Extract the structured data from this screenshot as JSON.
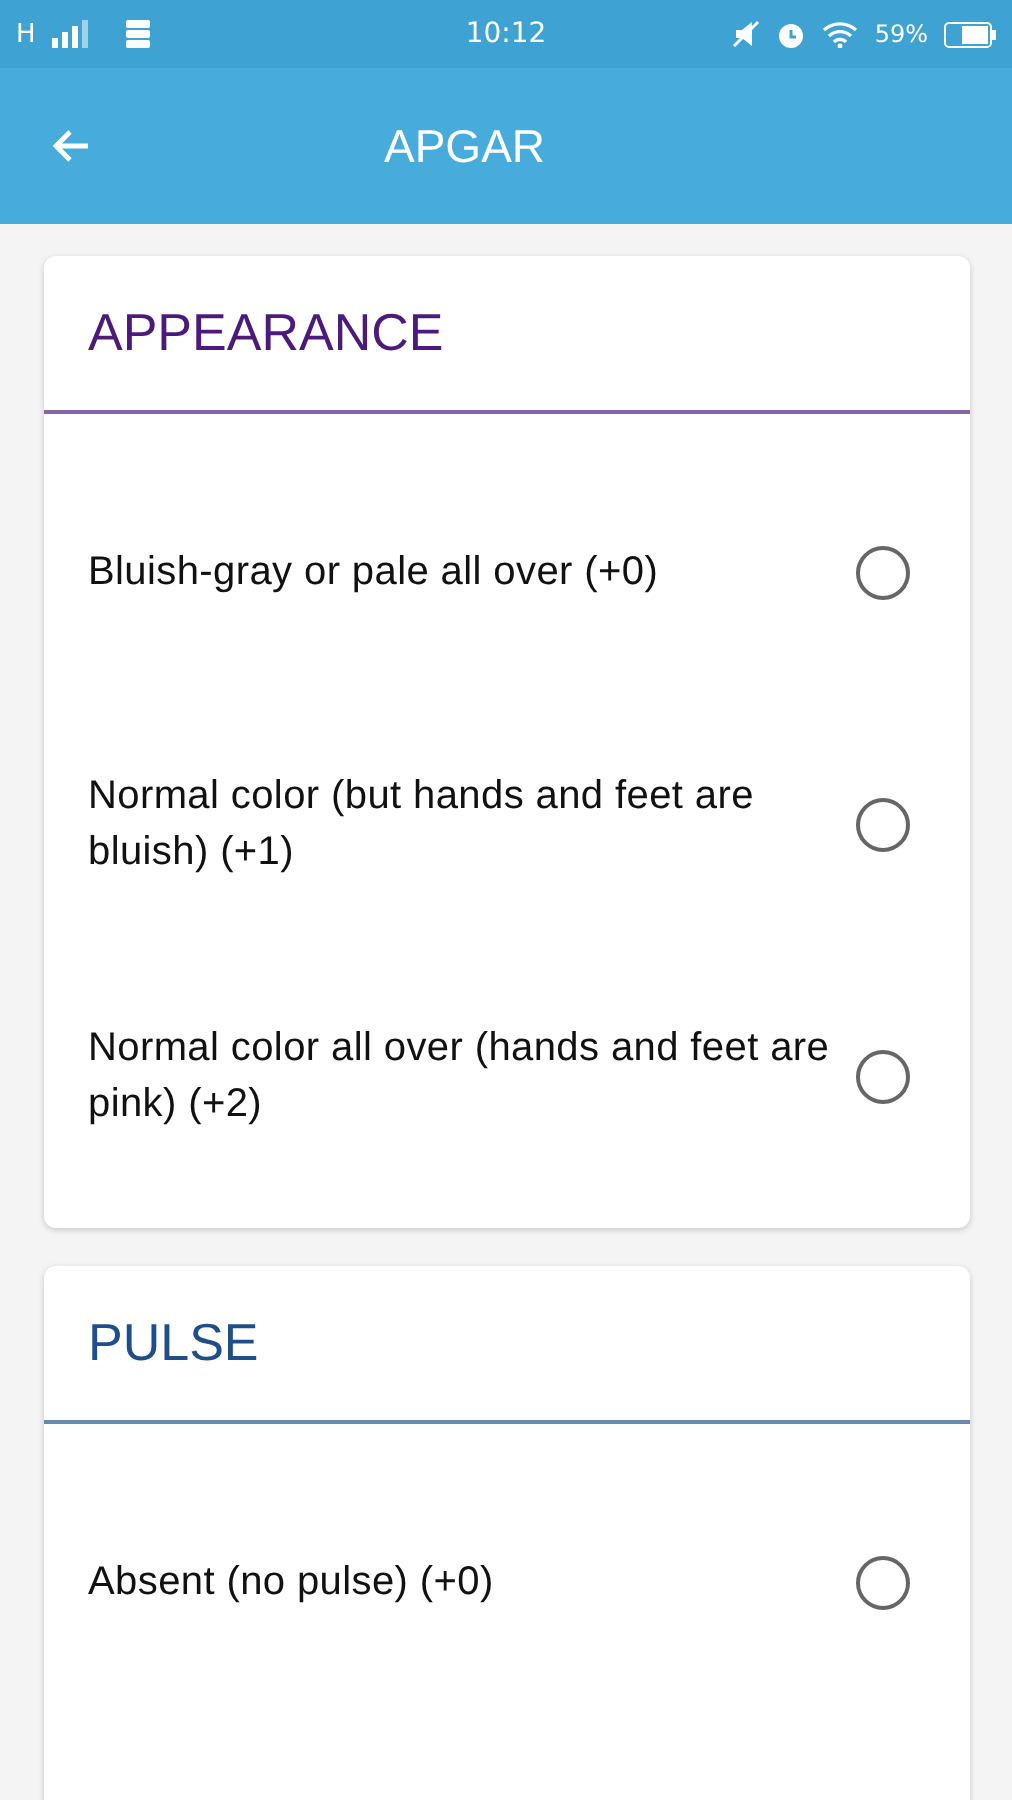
{
  "status_bar": {
    "network": "H",
    "time": "10:12",
    "battery": "59%"
  },
  "app_bar": {
    "title": "APGAR"
  },
  "sections": [
    {
      "title": "APPEARANCE",
      "color": "#4b1a7a",
      "options": [
        {
          "label": "Bluish-gray or pale all over (+0)",
          "selected": false
        },
        {
          "label": "Normal color (but hands and feet are bluish) (+1)",
          "selected": false
        },
        {
          "label": "Normal color all over (hands and feet are pink) (+2)",
          "selected": false
        }
      ]
    },
    {
      "title": "PULSE",
      "color": "#1f4e8a",
      "options": [
        {
          "label": "Absent (no pulse) (+0)",
          "selected": false
        }
      ]
    }
  ]
}
